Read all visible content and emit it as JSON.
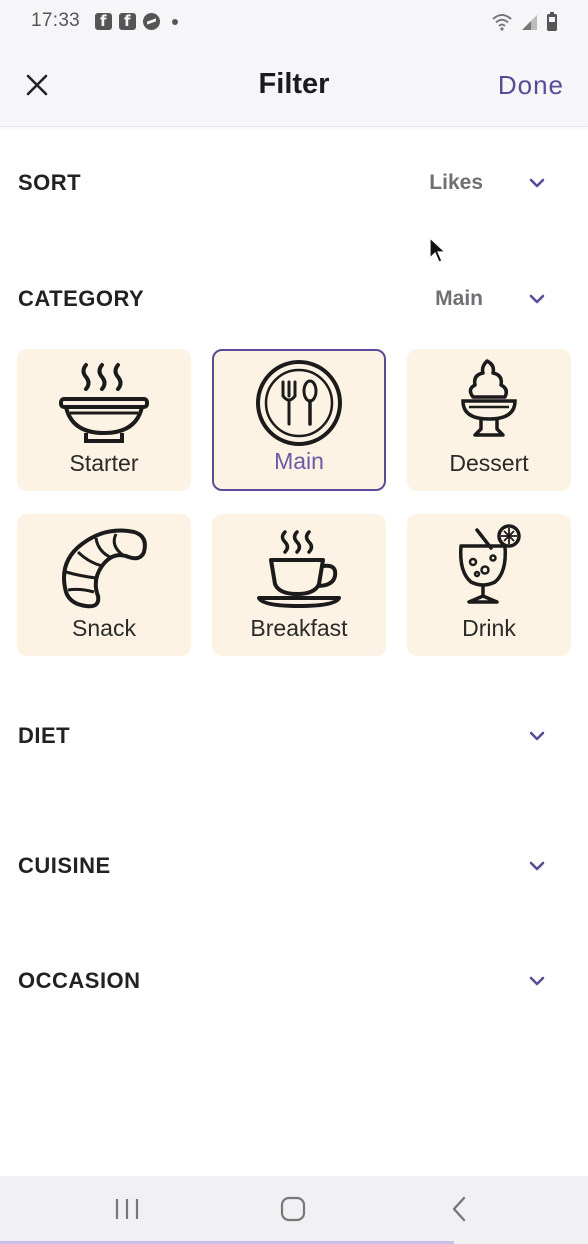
{
  "status_bar": {
    "time": "17:33",
    "left_icons": [
      "facebook-icon",
      "facebook-icon",
      "messenger-icon",
      "dot-icon"
    ],
    "right_icons": [
      "wifi-icon",
      "signal-icon",
      "battery-icon"
    ]
  },
  "app_bar": {
    "title": "Filter",
    "done_label": "Done",
    "close_icon": "close-icon"
  },
  "sections": {
    "sort": {
      "label": "SORT",
      "value": "Likes"
    },
    "category": {
      "label": "CATEGORY",
      "value": "Main"
    },
    "diet": {
      "label": "DIET",
      "value": ""
    },
    "cuisine": {
      "label": "CUISINE",
      "value": ""
    },
    "occasion": {
      "label": "OCCASION",
      "value": ""
    }
  },
  "categories": [
    {
      "label": "Starter",
      "icon": "soup-bowl-icon",
      "selected": false
    },
    {
      "label": "Main",
      "icon": "plate-cutlery-icon",
      "selected": true
    },
    {
      "label": "Dessert",
      "icon": "ice-cream-icon",
      "selected": false
    },
    {
      "label": "Snack",
      "icon": "croissant-icon",
      "selected": false
    },
    {
      "label": "Breakfast",
      "icon": "coffee-cup-icon",
      "selected": false
    },
    {
      "label": "Drink",
      "icon": "cocktail-icon",
      "selected": false
    }
  ],
  "nav_bar": {
    "buttons": [
      "recents-icon",
      "home-icon",
      "back-icon"
    ]
  },
  "colors": {
    "accent": "#5b4b96",
    "tile_background": "#fdf3e4",
    "app_bar_background": "#f6f6f8"
  }
}
